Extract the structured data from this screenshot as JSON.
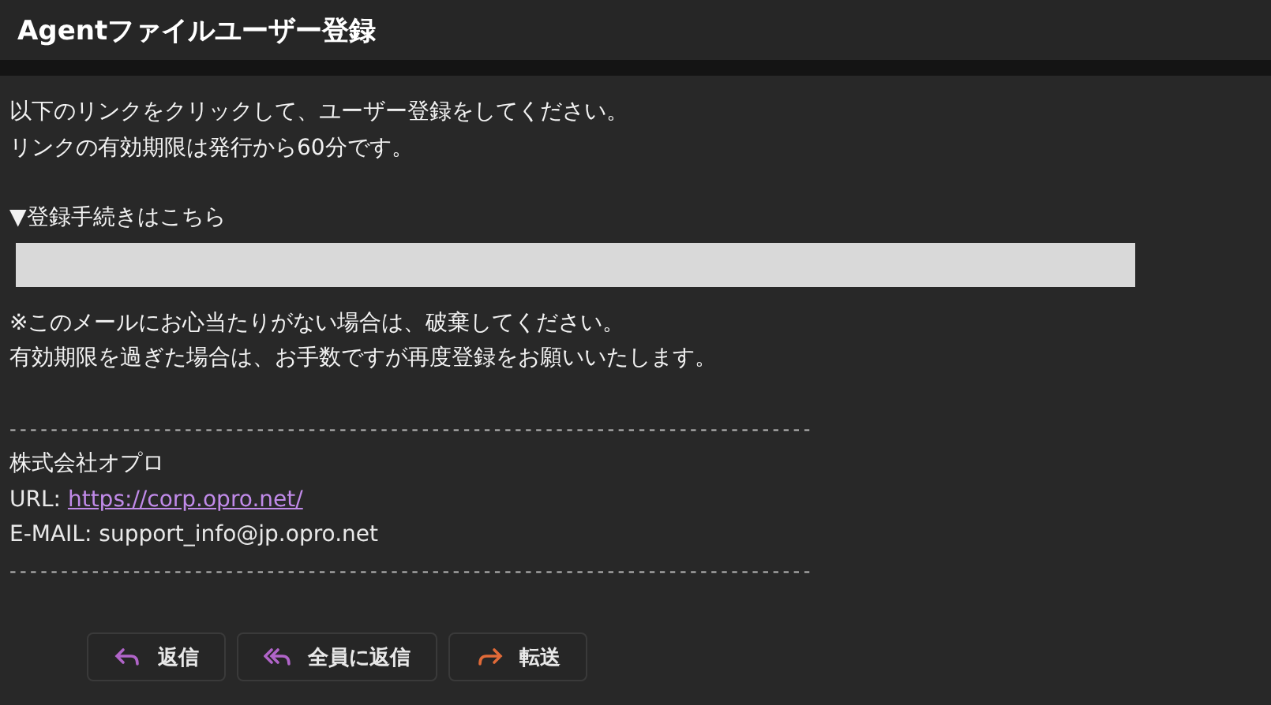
{
  "header": {
    "title": "Agentファイルユーザー登録"
  },
  "body": {
    "lines": [
      "以下のリンクをクリックして、ユーザー登録をしてください。",
      "リンクの有効期限は発行から60分です。"
    ],
    "section_heading": "▼登録手続きはこちら",
    "notes": [
      "※このメールにお心当たりがない場合は、破棄してください。",
      "有効期限を過ぎた場合は、お手数ですが再度登録をお願いいたします。"
    ],
    "separator": "------------------------------------------------------------------------------",
    "signature": {
      "company": "株式会社オプロ",
      "url_label": "URL:",
      "url": "https://corp.opro.net/",
      "email": "E-MAIL: support_info@jp.opro.net"
    },
    "separator_end": "------------------------------------------------------------------------------"
  },
  "actions": [
    {
      "kind": "reply",
      "label": "返信"
    },
    {
      "kind": "reply_all",
      "label": "全員に返信"
    },
    {
      "kind": "forward",
      "label": "転送"
    }
  ]
}
